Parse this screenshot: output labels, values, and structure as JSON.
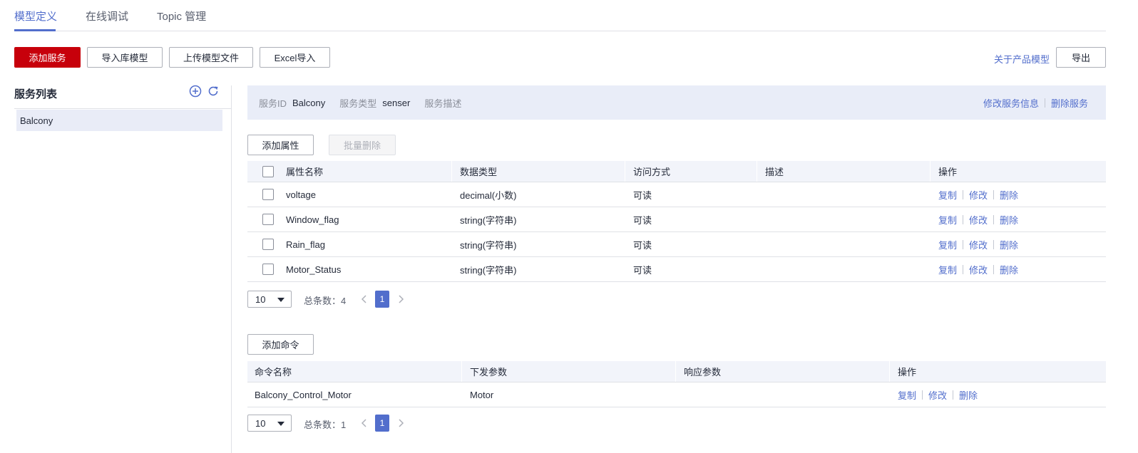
{
  "tabs": [
    {
      "label": "模型定义"
    },
    {
      "label": "在线调试"
    },
    {
      "label": "Topic 管理"
    }
  ],
  "toolbar": {
    "add_service": "添加服务",
    "import_library_model": "导入库模型",
    "upload_model_file": "上传模型文件",
    "excel_import": "Excel导入",
    "about_product_model": "关于产品模型",
    "export": "导出"
  },
  "sidebar": {
    "title": "服务列表",
    "items": [
      {
        "label": "Balcony"
      }
    ]
  },
  "service": {
    "id_label": "服务ID",
    "id_value": "Balcony",
    "type_label": "服务类型",
    "type_value": "senser",
    "desc_label": "服务描述",
    "edit": "修改服务信息",
    "delete": "删除服务"
  },
  "properties": {
    "add_button": "添加属性",
    "batch_delete": "批量删除",
    "headers": [
      "属性名称",
      "数据类型",
      "访问方式",
      "描述",
      "操作"
    ],
    "rows": [
      {
        "name": "voltage",
        "type": "decimal(小数)",
        "access": "可读",
        "desc": ""
      },
      {
        "name": "Window_flag",
        "type": "string(字符串)",
        "access": "可读",
        "desc": ""
      },
      {
        "name": "Rain_flag",
        "type": "string(字符串)",
        "access": "可读",
        "desc": ""
      },
      {
        "name": "Motor_Status",
        "type": "string(字符串)",
        "access": "可读",
        "desc": ""
      }
    ],
    "ops": {
      "copy": "复制",
      "edit": "修改",
      "delete": "删除"
    },
    "pager": {
      "page_size": "10",
      "total_text": "总条数：4",
      "current_page": "1"
    }
  },
  "commands": {
    "add_button": "添加命令",
    "headers": [
      "命令名称",
      "下发参数",
      "响应参数",
      "操作"
    ],
    "rows": [
      {
        "name": "Balcony_Control_Motor",
        "params": "Motor",
        "response": ""
      }
    ],
    "ops": {
      "copy": "复制",
      "edit": "修改",
      "delete": "删除"
    },
    "pager": {
      "page_size": "10",
      "total_text": "总条数：1",
      "current_page": "1"
    }
  },
  "colors": {
    "accent": "#526ecc",
    "primary_button": "#c7000b",
    "header_bg": "#f2f4fa",
    "info_bar_bg": "#e9edf8"
  }
}
